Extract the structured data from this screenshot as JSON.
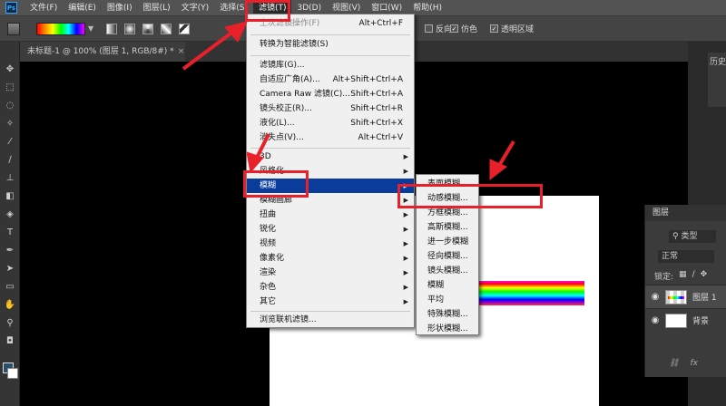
{
  "app": {
    "logo": "Ps"
  },
  "menubar": {
    "items": [
      "文件(F)",
      "编辑(E)",
      "图像(I)",
      "图层(L)",
      "文字(Y)",
      "选择(S)",
      "滤镜(T)",
      "3D(D)",
      "视图(V)",
      "窗口(W)",
      "帮助(H)"
    ]
  },
  "options": {
    "reverse_label": "反向",
    "dither_label": "仿色",
    "transparency_label": "透明区域"
  },
  "document": {
    "tab_title": "未标题-1 @ 100% (图层 1, RGB/8#) *",
    "close_glyph": "×"
  },
  "filter_menu": {
    "last_filter": {
      "label": "上次滤镜操作(F)",
      "shortcut": "Alt+Ctrl+F"
    },
    "convert_smart": "转换为智能滤镜(S)",
    "gallery": "滤镜库(G)...",
    "adaptive_wide": {
      "label": "自适应广角(A)...",
      "shortcut": "Alt+Shift+Ctrl+A"
    },
    "camera_raw": {
      "label": "Camera Raw 滤镜(C)...",
      "shortcut": "Shift+Ctrl+A"
    },
    "lens_correction": {
      "label": "镜头校正(R)...",
      "shortcut": "Shift+Ctrl+R"
    },
    "liquify": {
      "label": "液化(L)...",
      "shortcut": "Shift+Ctrl+X"
    },
    "vanishing_point": {
      "label": "消失点(V)...",
      "shortcut": "Alt+Ctrl+V"
    },
    "groups": [
      "3D",
      "风格化",
      "模糊",
      "模糊画廊",
      "扭曲",
      "锐化",
      "视频",
      "像素化",
      "渲染",
      "杂色",
      "其它"
    ],
    "browse_online": "浏览联机滤镜..."
  },
  "blur_submenu": {
    "items": [
      "表面模糊...",
      "动感模糊...",
      "方框模糊...",
      "高斯模糊...",
      "进一步模糊",
      "径向模糊...",
      "镜头模糊...",
      "模糊",
      "平均",
      "特殊模糊...",
      "形状模糊..."
    ]
  },
  "layers_panel": {
    "tab": "图层",
    "filter_label": "类型",
    "blend_mode": "正常",
    "lock_label": "锁定:",
    "layers": [
      {
        "name": "图层 1",
        "selected": true
      },
      {
        "name": "背景",
        "selected": false
      }
    ],
    "footer_fx": "fx"
  },
  "history_panel": {
    "tab": "历史"
  },
  "colors": {
    "highlight": "#0a3c9c",
    "annotation_red": "#e8202a",
    "foreground": "#2c4f6a",
    "background": "#ffffff"
  }
}
